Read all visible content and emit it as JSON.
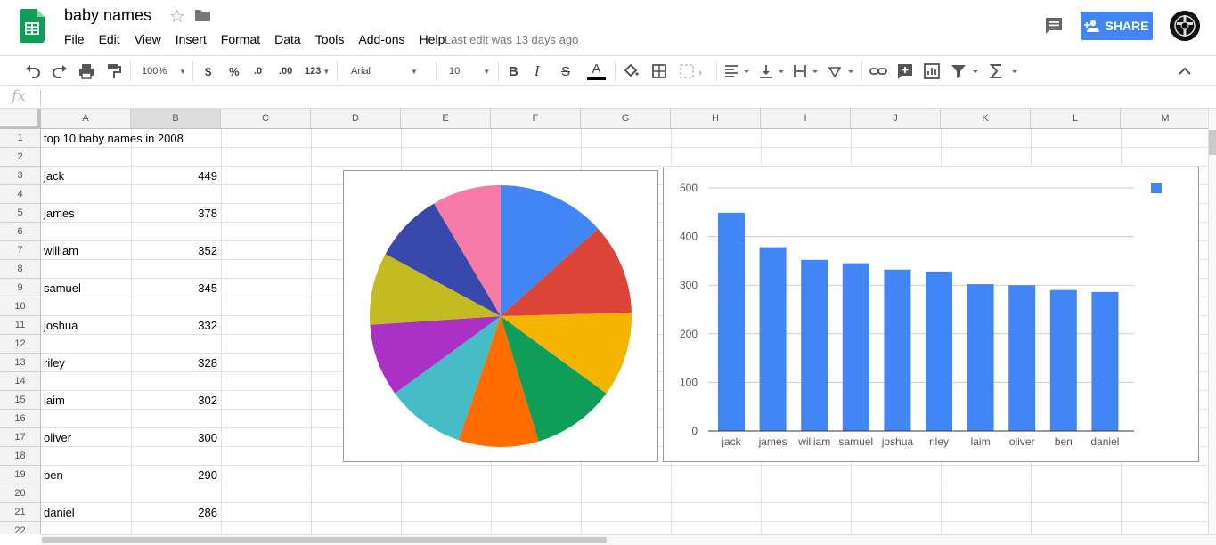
{
  "doc": {
    "title": "baby names",
    "last_edit": "Last edit was 13 days ago",
    "share_label": "SHARE"
  },
  "menu": [
    "File",
    "Edit",
    "View",
    "Insert",
    "Format",
    "Data",
    "Tools",
    "Add-ons",
    "Help"
  ],
  "toolbar": {
    "zoom": "100%",
    "currency": "$",
    "percent": "%",
    "dec_less": ".0",
    "dec_more": ".00",
    "number_format": "123",
    "font": "Arial",
    "font_size": "10"
  },
  "formula_bar": {
    "fx": "fx",
    "value": ""
  },
  "columns": [
    "A",
    "B",
    "C",
    "D",
    "E",
    "F",
    "G",
    "H",
    "I",
    "J",
    "K",
    "L",
    "M"
  ],
  "rows": [
    "1",
    "2",
    "3",
    "4",
    "5",
    "6",
    "7",
    "8",
    "9",
    "10",
    "11",
    "12",
    "13",
    "14",
    "15",
    "16",
    "17",
    "18",
    "19",
    "20",
    "21",
    "22"
  ],
  "cells": {
    "A1": "top 10 baby names in 2008",
    "names": [
      " jack",
      "james",
      "william",
      "samuel",
      " joshua",
      "riley",
      "laim",
      "oliver",
      "ben",
      "daniel"
    ],
    "counts": [
      "449",
      "378",
      "352",
      "345",
      "332",
      "328",
      "302",
      "300",
      "290",
      "286"
    ]
  },
  "chart_data": [
    {
      "type": "pie",
      "categories": [
        "jack",
        "james",
        "william",
        "samuel",
        "joshua",
        "riley",
        "laim",
        "oliver",
        "ben",
        "daniel"
      ],
      "values": [
        449,
        378,
        352,
        345,
        332,
        328,
        302,
        300,
        290,
        286
      ],
      "colors": [
        "#4285f4",
        "#db4437",
        "#f4b400",
        "#0f9d58",
        "#ff6d00",
        "#46bdc6",
        "#ab30c4",
        "#c2bb22",
        "#3949ab",
        "#f77ba6"
      ],
      "title": "",
      "legend": "none"
    },
    {
      "type": "bar",
      "categories": [
        "jack",
        "james",
        "william",
        "samuel",
        "joshua",
        "riley",
        "laim",
        "oliver",
        "ben",
        "daniel"
      ],
      "series": [
        {
          "values": [
            449,
            378,
            352,
            345,
            332,
            328,
            302,
            300,
            290,
            286
          ],
          "color": "#4285f4"
        }
      ],
      "y_ticks": [
        "0",
        "100",
        "200",
        "300",
        "400",
        "500"
      ],
      "ylim": [
        0,
        500
      ],
      "grid": true,
      "legend": "top-right",
      "title": "",
      "xlabel": "",
      "ylabel": ""
    }
  ]
}
